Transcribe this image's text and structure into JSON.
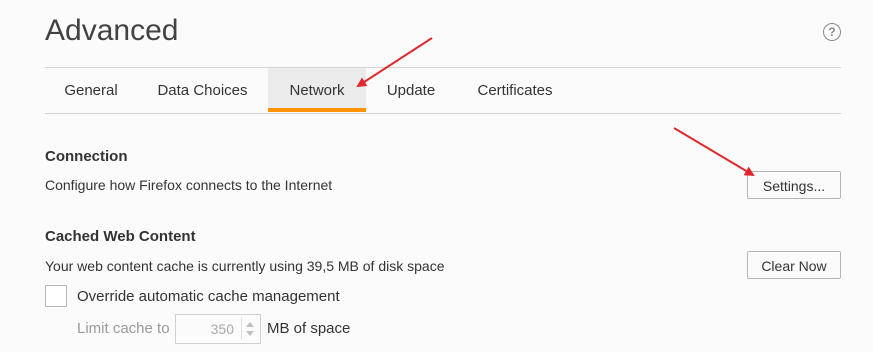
{
  "page": {
    "title": "Advanced",
    "help_icon": "help-icon",
    "help_glyph": "?"
  },
  "tabs": [
    {
      "label": "General",
      "selected": false
    },
    {
      "label": "Data Choices",
      "selected": false
    },
    {
      "label": "Network",
      "selected": true
    },
    {
      "label": "Update",
      "selected": false
    },
    {
      "label": "Certificates",
      "selected": false
    }
  ],
  "connection": {
    "title": "Connection",
    "description": "Configure how Firefox connects to the Internet",
    "settings_button": "Settings..."
  },
  "cache": {
    "title": "Cached Web Content",
    "description": "Your web content cache is currently using 39,5 MB of disk space",
    "clear_button": "Clear Now",
    "override_label": "Override automatic cache management",
    "override_checked": false,
    "limit_label": "Limit cache to",
    "limit_value": "350",
    "limit_unit": "MB of space"
  },
  "colors": {
    "accent_tab": "#ff9400",
    "annotation_arrow": "#e0282d"
  }
}
